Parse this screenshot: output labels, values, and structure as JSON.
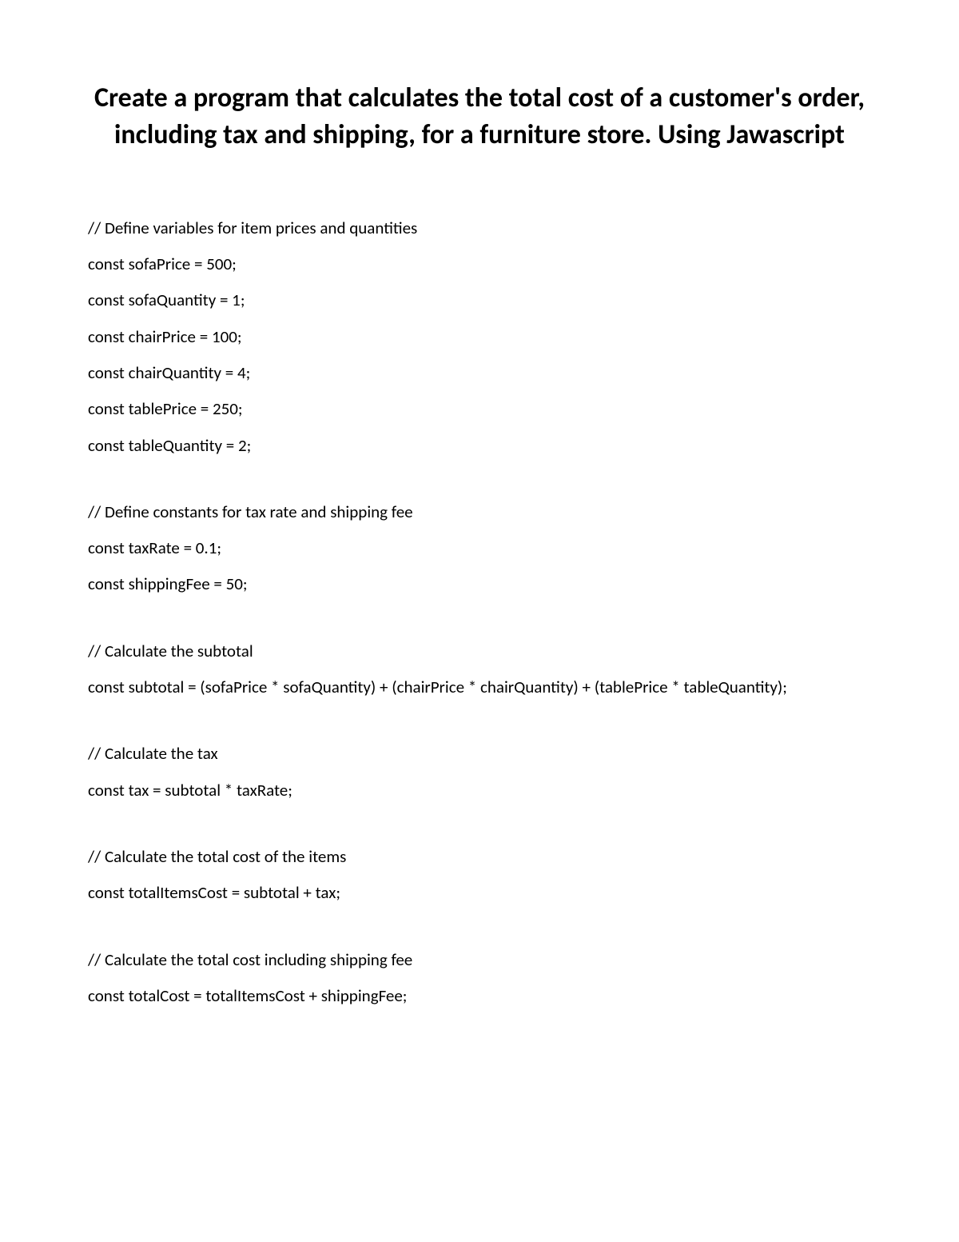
{
  "title": "Create a program that calculates the total cost of a customer's order, including tax and shipping, for a furniture store. Using Jawascript",
  "code": {
    "l1": "// Define variables for item prices and quantities",
    "l2": "const sofaPrice = 500;",
    "l3": "const sofaQuantity = 1;",
    "l4": "const chairPrice = 100;",
    "l5": "const chairQuantity = 4;",
    "l6": "const tablePrice = 250;",
    "l7": "const tableQuantity = 2;",
    "l8": "// Define constants for tax rate and shipping fee",
    "l9": "const taxRate = 0.1;",
    "l10": "const shippingFee = 50;",
    "l11": "// Calculate the subtotal",
    "l12": "const subtotal = (sofaPrice * sofaQuantity) + (chairPrice * chairQuantity) + (tablePrice * tableQuantity);",
    "l13": "// Calculate the tax",
    "l14": "const tax = subtotal * taxRate;",
    "l15": "// Calculate the total cost of the items",
    "l16": "const totalItemsCost = subtotal + tax;",
    "l17": "// Calculate the total cost including shipping fee",
    "l18": "const totalCost = totalItemsCost + shippingFee;"
  }
}
